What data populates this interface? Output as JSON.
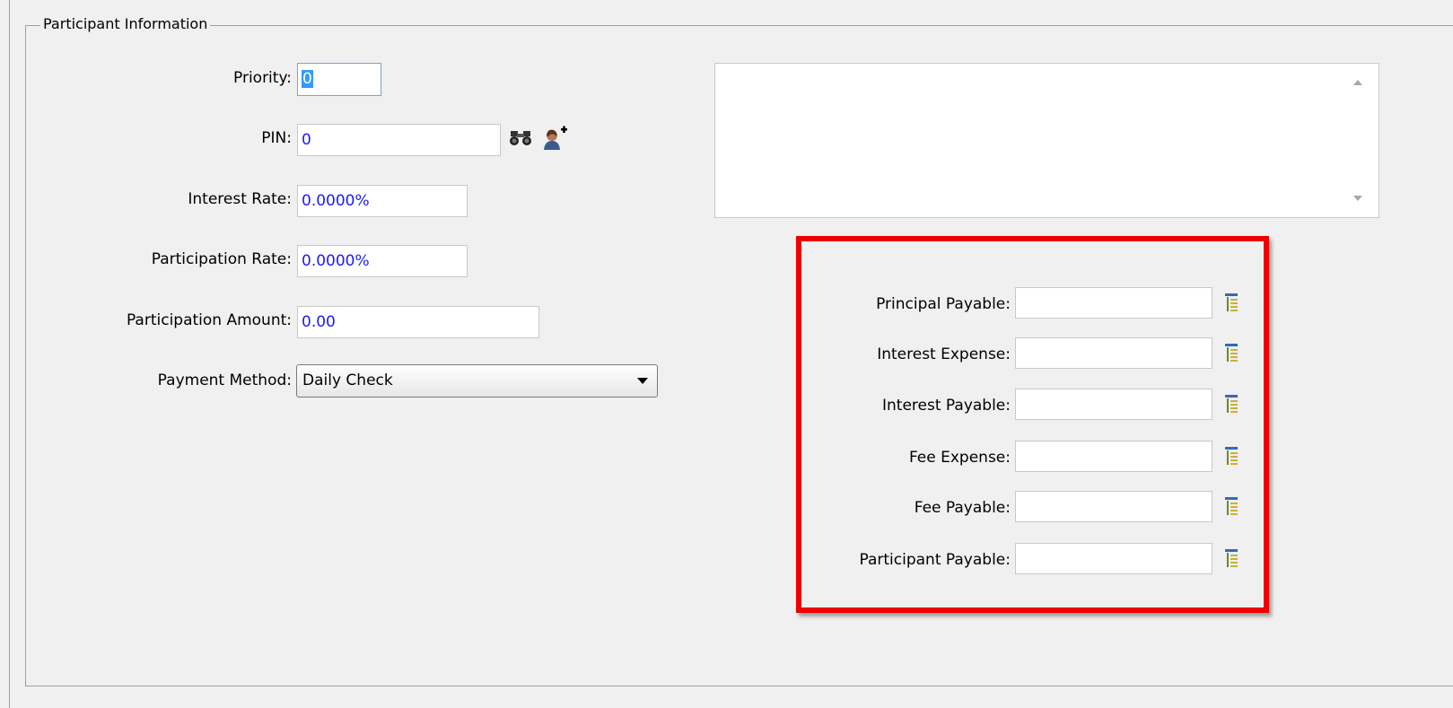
{
  "group": {
    "title": "Participant Information"
  },
  "fields": {
    "priority": {
      "label": "Priority:",
      "value": "0"
    },
    "pin": {
      "label": "PIN:",
      "value": "0"
    },
    "interest_rate": {
      "label": "Interest Rate:",
      "value": "0.0000%"
    },
    "participation_rate": {
      "label": "Participation Rate:",
      "value": "0.0000%"
    },
    "participation_amount": {
      "label": "Participation Amount:",
      "value": "0.00"
    },
    "payment_method": {
      "label": "Payment Method:",
      "value": "Daily Check"
    }
  },
  "accounts": [
    {
      "label": "Principal Payable:",
      "value": ""
    },
    {
      "label": "Interest Expense:",
      "value": ""
    },
    {
      "label": "Interest Payable:",
      "value": ""
    },
    {
      "label": "Fee Expense:",
      "value": ""
    },
    {
      "label": "Fee Payable:",
      "value": ""
    },
    {
      "label": "Participant Payable:",
      "value": ""
    }
  ],
  "icons": {
    "pin_search": "binoculars-icon",
    "pin_add": "add-person-icon",
    "account_lookup": "gl-account-lookup-icon"
  },
  "colors": {
    "value_text": "#1a1aff",
    "highlight_border": "#ee0000",
    "selection": "#3399ff"
  }
}
